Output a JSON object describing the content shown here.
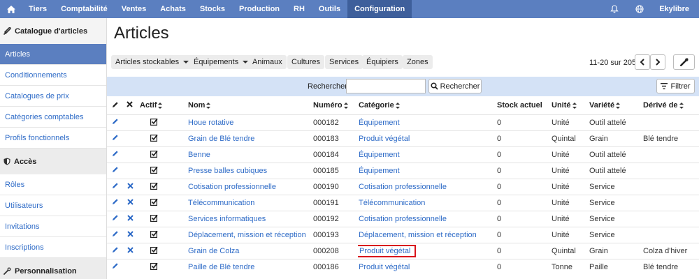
{
  "nav": {
    "items": [
      "Tiers",
      "Comptabilité",
      "Ventes",
      "Achats",
      "Stocks",
      "Production",
      "RH",
      "Outils",
      "Configuration"
    ],
    "active": "Configuration",
    "user": "Ekylibre"
  },
  "sidebar": {
    "sections": [
      {
        "title": "Catalogue d'articles",
        "icon": "puzzle-icon",
        "items": [
          "Articles",
          "Conditionnements",
          "Catalogues de prix",
          "Catégories comptables",
          "Profils fonctionnels"
        ]
      },
      {
        "title": "Accès",
        "icon": "shield-icon",
        "items": [
          "Rôles",
          "Utilisateurs",
          "Invitations",
          "Inscriptions"
        ]
      },
      {
        "title": "Personnalisation",
        "icon": "wrench-icon",
        "items": []
      }
    ],
    "active_item": "Articles"
  },
  "page": {
    "title": "Articles"
  },
  "toolbar": {
    "filters": [
      {
        "label": "Articles stockables",
        "dropdown": true
      },
      {
        "label": "Équipements",
        "dropdown": true
      },
      {
        "label": "Animaux",
        "dropdown": false
      },
      {
        "label": "Cultures",
        "dropdown": false
      },
      {
        "label": "Services",
        "dropdown": false
      },
      {
        "label": "Équipiers",
        "dropdown": false
      },
      {
        "label": "Zones",
        "dropdown": false
      }
    ],
    "pager": "11-20 sur 205"
  },
  "search": {
    "label": "Rechercher",
    "value": "",
    "button": "Rechercher",
    "filter_button": "Filtrer"
  },
  "table": {
    "headers": {
      "actif": "Actif",
      "nom": "Nom",
      "numero": "Numéro",
      "categorie": "Catégorie",
      "stock": "Stock actuel",
      "unite": "Unité",
      "variete": "Variété",
      "derive": "Dérivé de"
    },
    "rows": [
      {
        "deletable": false,
        "nom": "Houe rotative",
        "numero": "000182",
        "categorie": "Équipement",
        "stock": "0",
        "unite": "Unité",
        "variete": "Outil attelé",
        "derive": ""
      },
      {
        "deletable": false,
        "nom": "Grain de Blé tendre",
        "numero": "000183",
        "categorie": "Produit végétal",
        "stock": "0",
        "unite": "Quintal",
        "variete": "Grain",
        "derive": "Blé tendre"
      },
      {
        "deletable": false,
        "nom": "Benne",
        "numero": "000184",
        "categorie": "Équipement",
        "stock": "0",
        "unite": "Unité",
        "variete": "Outil attelé",
        "derive": ""
      },
      {
        "deletable": false,
        "nom": "Presse balles cubiques",
        "numero": "000185",
        "categorie": "Équipement",
        "stock": "0",
        "unite": "Unité",
        "variete": "Outil attelé",
        "derive": ""
      },
      {
        "deletable": true,
        "nom": "Cotisation professionnelle",
        "numero": "000190",
        "categorie": "Cotisation professionnelle",
        "stock": "0",
        "unite": "Unité",
        "variete": "Service",
        "derive": ""
      },
      {
        "deletable": true,
        "nom": "Télécommunication",
        "numero": "000191",
        "categorie": "Télécommunication",
        "stock": "0",
        "unite": "Unité",
        "variete": "Service",
        "derive": ""
      },
      {
        "deletable": true,
        "nom": "Services informatiques",
        "numero": "000192",
        "categorie": "Cotisation professionnelle",
        "stock": "0",
        "unite": "Unité",
        "variete": "Service",
        "derive": ""
      },
      {
        "deletable": true,
        "nom": "Déplacement, mission et réception",
        "numero": "000193",
        "categorie": "Déplacement, mission et réception",
        "stock": "0",
        "unite": "Unité",
        "variete": "Service",
        "derive": ""
      },
      {
        "deletable": true,
        "nom": "Grain de Colza",
        "numero": "000208",
        "categorie": "Produit végétal",
        "stock": "0",
        "unite": "Quintal",
        "variete": "Grain",
        "derive": "Colza d'hiver",
        "highlight": true
      },
      {
        "deletable": false,
        "nom": "Paille de Blé tendre",
        "numero": "000186",
        "categorie": "Produit végétal",
        "stock": "0",
        "unite": "Tonne",
        "variete": "Paille",
        "derive": "Blé tendre"
      }
    ]
  },
  "colors": {
    "nav_bg": "#5b7fc0",
    "nav_active": "#3e5f9b",
    "link": "#2e6bc7",
    "search_bar": "#d4e2f6",
    "highlight": "#d9141b"
  }
}
